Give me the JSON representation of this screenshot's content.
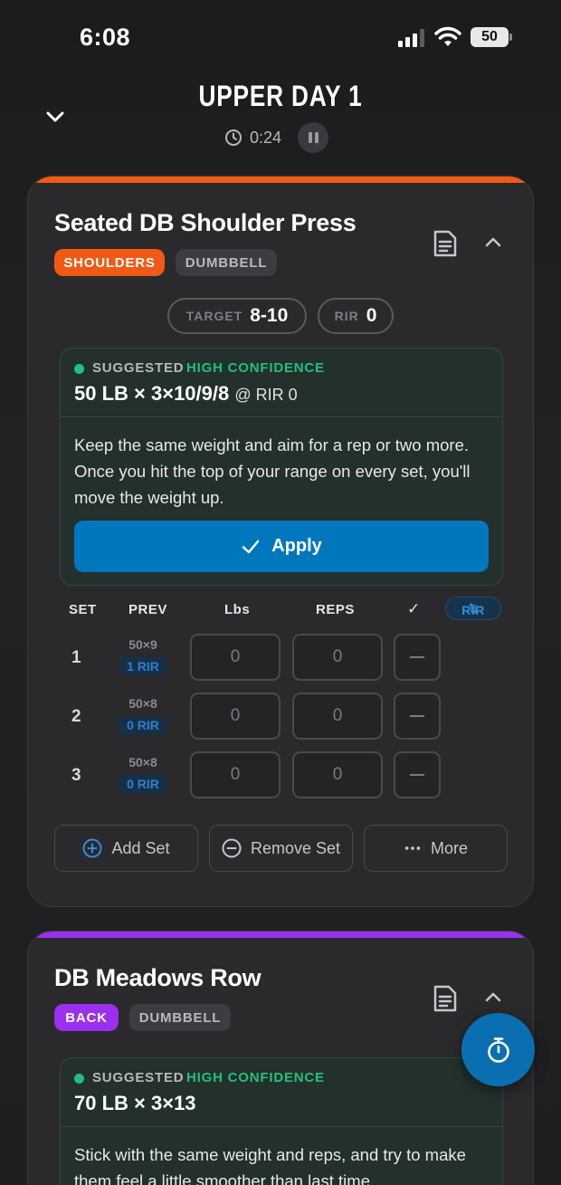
{
  "status_bar": {
    "time": "6:08",
    "battery": "50"
  },
  "header": {
    "title": "UPPER DAY 1",
    "elapsed": "0:24"
  },
  "exercises": [
    {
      "name": "Seated DB Shoulder Press",
      "muscle": "SHOULDERS",
      "equipment": "DUMBBELL",
      "accent_color": "#f05a14",
      "muscle_color": "#f05a14",
      "target_label": "TARGET",
      "target_value": "8-10",
      "rir_label": "RIR",
      "rir_value": "0",
      "suggestion": {
        "label": "SUGGESTED",
        "confidence": "HIGH CONFIDENCE",
        "prescription": "50 LB × 3×10/9/8",
        "rir": "@ RIR 0",
        "note": "Keep the same weight and aim for a rep or two more. Once you hit the top of your range on every set, you'll move the weight up.",
        "apply_label": "Apply"
      },
      "columns": {
        "set": "SET",
        "prev": "PREV",
        "weight": "Lbs",
        "reps": "REPS",
        "done": "✓",
        "rir_toggle": "RIR"
      },
      "sets": [
        {
          "num": "1",
          "prev": "50×9",
          "prev_rir": "1 RIR",
          "weight": "0",
          "reps": "0"
        },
        {
          "num": "2",
          "prev": "50×8",
          "prev_rir": "0 RIR",
          "weight": "0",
          "reps": "0"
        },
        {
          "num": "3",
          "prev": "50×8",
          "prev_rir": "0 RIR",
          "weight": "0",
          "reps": "0"
        }
      ],
      "actions": {
        "add": "Add Set",
        "remove": "Remove Set",
        "more": "More"
      }
    },
    {
      "name": "DB Meadows Row",
      "muscle": "BACK",
      "equipment": "DUMBBELL",
      "accent_color": "#9b30f0",
      "muscle_color": "#9b30f0",
      "suggestion": {
        "label": "SUGGESTED",
        "confidence": "HIGH CONFIDENCE",
        "prescription": "70 LB × 3×13",
        "note": "Stick with the same weight and reps, and try to make them feel a little smoother than last time."
      }
    }
  ],
  "colors": {
    "confidence": "#22c07a",
    "apply": "#0077bd",
    "fab": "#0a6fb0"
  },
  "icons": [
    "chevron-down-icon",
    "clock-icon",
    "pause-icon",
    "note-icon",
    "chevron-up-icon",
    "check-icon",
    "plus-circle-icon",
    "minus-circle-icon",
    "more-icon",
    "stopwatch-icon",
    "swap-icon"
  ]
}
